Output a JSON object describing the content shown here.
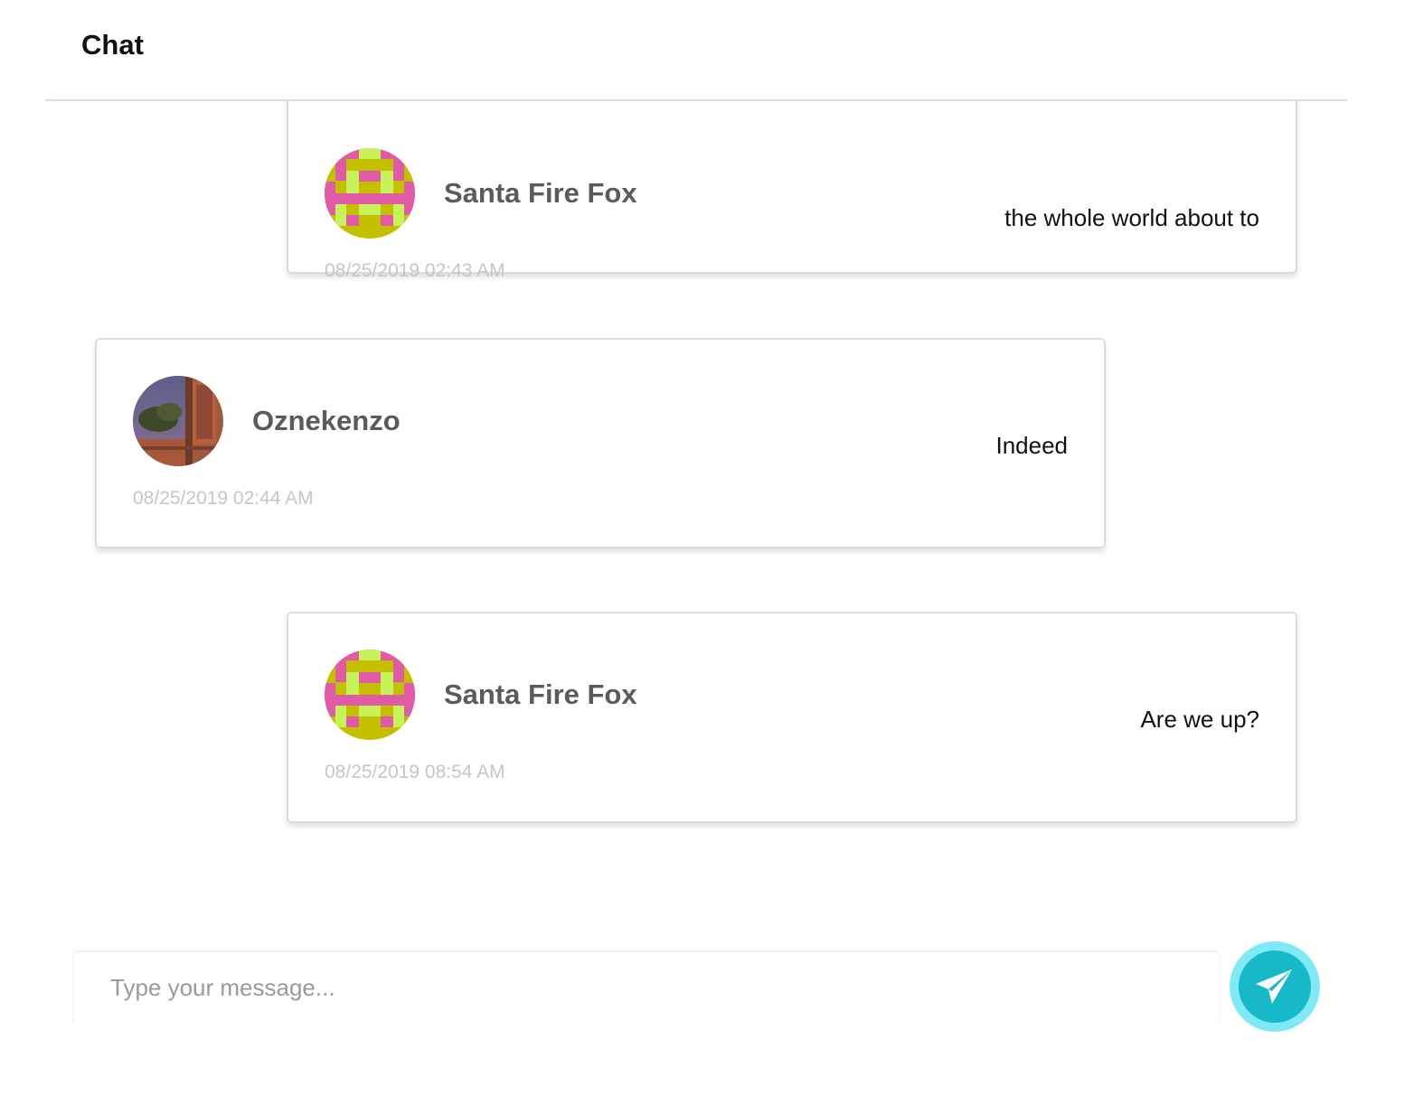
{
  "header": {
    "title": "Chat"
  },
  "messages": [
    {
      "author": "Santa Fire Fox",
      "timestamp": "08/25/2019 02:43 AM",
      "text": "the whole world about to",
      "avatar": "pixel-pattern-avatar",
      "alignment": "right"
    },
    {
      "author": "Oznekenzo",
      "timestamp": "08/25/2019 02:44 AM",
      "text": "Indeed",
      "avatar": "painting-avatar",
      "alignment": "left"
    },
    {
      "author": "Santa Fire Fox",
      "timestamp": "08/25/2019 08:54 AM",
      "text": "Are we up?",
      "avatar": "pixel-pattern-avatar",
      "alignment": "right"
    }
  ],
  "composer": {
    "placeholder": "Type your message...",
    "value": ""
  },
  "send_button": {
    "icon": "paper-plane-icon"
  },
  "colors": {
    "accent": "#17b9c8",
    "accent_ring": "#7fe9f7",
    "author": "#5b5b5b",
    "timestamp": "#c6c6c6",
    "avatar_pink": "#e05aa5",
    "avatar_olive": "#c4c000",
    "avatar_lime": "#c8f25a"
  }
}
